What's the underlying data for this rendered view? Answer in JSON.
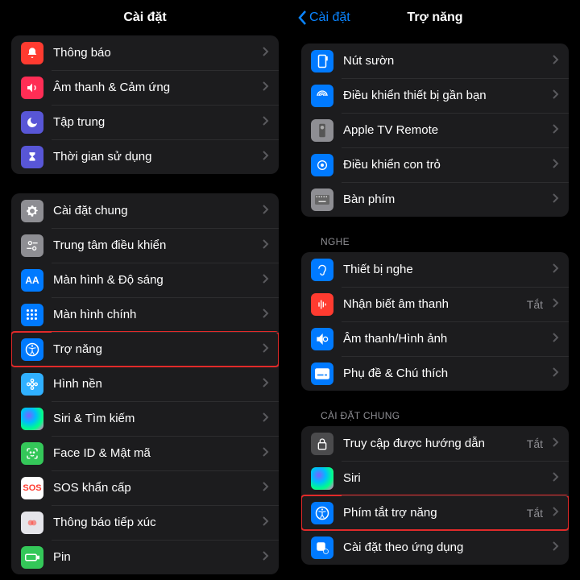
{
  "left": {
    "navTitle": "Cài đặt",
    "group1": [
      {
        "label": "Thông báo"
      },
      {
        "label": "Âm thanh & Cảm ứng"
      },
      {
        "label": "Tập trung"
      },
      {
        "label": "Thời gian sử dụng"
      }
    ],
    "group2": [
      {
        "label": "Cài đặt chung"
      },
      {
        "label": "Trung tâm điều khiển"
      },
      {
        "label": "Màn hình & Độ sáng"
      },
      {
        "label": "Màn hình chính"
      },
      {
        "label": "Trợ năng"
      },
      {
        "label": "Hình nền"
      },
      {
        "label": "Siri & Tìm kiếm"
      },
      {
        "label": "Face ID & Mật mã"
      },
      {
        "label": "SOS khẩn cấp"
      },
      {
        "label": "Thông báo tiếp xúc"
      },
      {
        "label": "Pin"
      }
    ]
  },
  "right": {
    "backLabel": "Cài đặt",
    "navTitle": "Trợ năng",
    "group1": [
      {
        "label": "Nút sườn"
      },
      {
        "label": "Điều khiển thiết bị gần bạn"
      },
      {
        "label": "Apple TV Remote"
      },
      {
        "label": "Điều khiển con trỏ"
      },
      {
        "label": "Bàn phím"
      }
    ],
    "section2": "NGHE",
    "group2": [
      {
        "label": "Thiết bị nghe"
      },
      {
        "label": "Nhận biết âm thanh",
        "value": "Tắt"
      },
      {
        "label": "Âm thanh/Hình ảnh"
      },
      {
        "label": "Phụ đề & Chú thích"
      }
    ],
    "section3": "CÀI ĐẶT CHUNG",
    "group3": [
      {
        "label": "Truy cập được hướng dẫn",
        "value": "Tắt"
      },
      {
        "label": "Siri"
      },
      {
        "label": "Phím tắt trợ năng",
        "value": "Tắt"
      },
      {
        "label": "Cài đặt theo ứng dụng"
      }
    ]
  }
}
